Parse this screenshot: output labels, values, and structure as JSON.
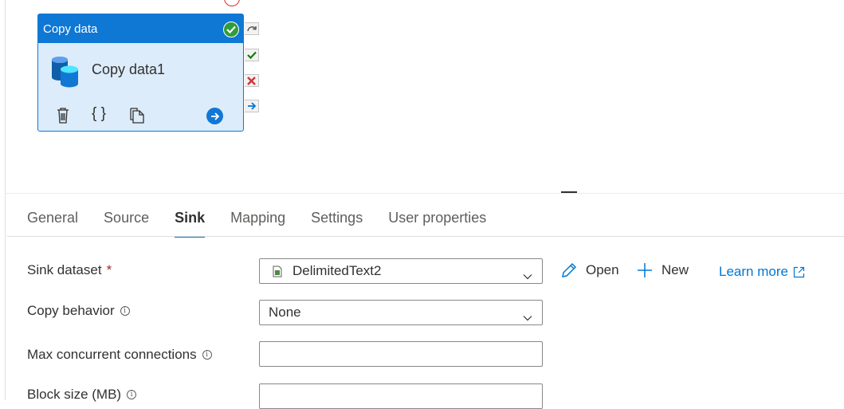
{
  "activity": {
    "header_title": "Copy data",
    "name": "Copy data1",
    "icons": [
      "database-icon",
      "delete-icon",
      "code-icon",
      "clone-icon",
      "go-icon",
      "success-icon"
    ],
    "ports": [
      "skip-port-icon",
      "success-port-icon",
      "failure-port-icon",
      "completion-port-icon"
    ]
  },
  "tabs": [
    {
      "label": "General"
    },
    {
      "label": "Source"
    },
    {
      "label": "Sink",
      "active": true
    },
    {
      "label": "Mapping"
    },
    {
      "label": "Settings"
    },
    {
      "label": "User properties"
    }
  ],
  "form": {
    "sink_dataset": {
      "label": "Sink dataset",
      "required_marker": "*",
      "value": "DelimitedText2",
      "file_icon": "csv-file-icon"
    },
    "copy_behavior": {
      "label": "Copy behavior",
      "value": "None"
    },
    "max_concurrent": {
      "label": "Max concurrent connections",
      "value": ""
    },
    "block_size": {
      "label": "Block size (MB)",
      "value": ""
    },
    "info_glyph": "i"
  },
  "actions": {
    "open_label": "Open",
    "new_label": "New",
    "learn_more_label": "Learn more"
  },
  "colors": {
    "accent": "#0078d4",
    "activity_header": "#0f77d4",
    "activity_body": "#dcecfb",
    "success": "#2f9d3b",
    "failure": "#d13438",
    "required": "#a4262c"
  }
}
